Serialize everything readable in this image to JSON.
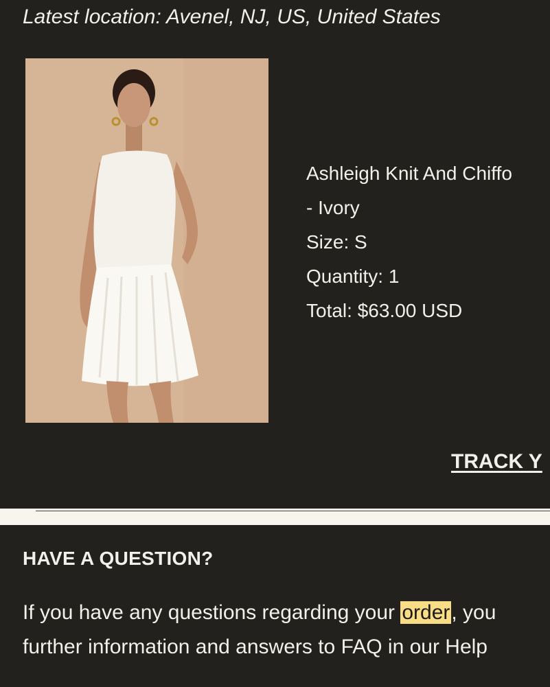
{
  "shipment": {
    "location_text": "Latest location: Avenel, NJ, US, United States"
  },
  "product": {
    "image_alt": "Model wearing an ivory sleeveless knit and chiffon mini dress",
    "name_line1": "Ashleigh Knit And Chiffo",
    "name_line2": "- Ivory",
    "size": "Size: S",
    "quantity": "Quantity: 1",
    "total": "Total: $63.00 USD"
  },
  "actions": {
    "track_label": "TRACK Y"
  },
  "help": {
    "heading": "HAVE A QUESTION?",
    "line1_before": "If you have any questions regarding your ",
    "line1_highlight": "order",
    "line1_after": ", you",
    "line2": "further information and answers to FAQ in our Help"
  },
  "colors": {
    "background": "#22211d",
    "text": "#f2f0ea",
    "highlight": "#f8dc86",
    "divider_band": "#f7f5ee"
  }
}
